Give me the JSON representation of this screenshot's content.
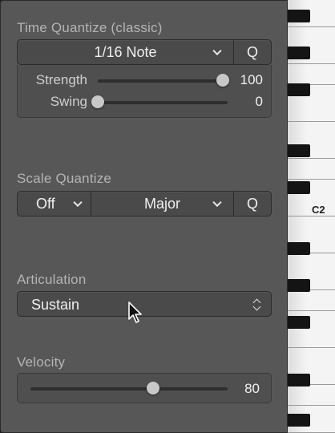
{
  "time_quantize": {
    "title": "Time Quantize (classic)",
    "note_value": "1/16 Note",
    "q_label": "Q",
    "strength": {
      "label": "Strength",
      "value": "100",
      "fraction": 1.0
    },
    "swing": {
      "label": "Swing",
      "value": "0",
      "fraction": 0.0
    }
  },
  "scale_quantize": {
    "title": "Scale Quantize",
    "root": "Off",
    "scale": "Major",
    "q_label": "Q"
  },
  "articulation": {
    "title": "Articulation",
    "value": "Sustain"
  },
  "velocity": {
    "title": "Velocity",
    "value": "80",
    "fraction": 0.62
  },
  "keyboard": {
    "octave_label": "C2"
  },
  "colors": {
    "panel": "#575757",
    "control": "#4a4a4a",
    "knob": "#c8c8c8"
  }
}
